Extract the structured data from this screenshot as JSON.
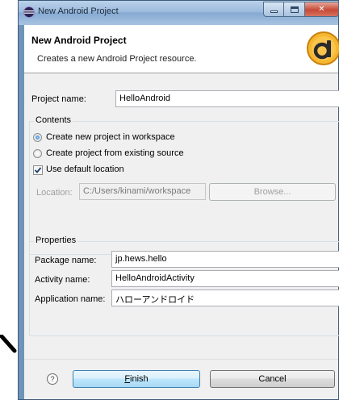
{
  "window": {
    "title": "New Android Project"
  },
  "banner": {
    "title": "New Android Project",
    "description": "Creates a new Android Project resource."
  },
  "project": {
    "name_label": "Project name:",
    "name_value": "HelloAndroid"
  },
  "contents": {
    "group_title": "Contents",
    "option_new": "Create new project in workspace",
    "option_existing": "Create project from existing source",
    "use_default_label": "Use default location",
    "location_label": "Location:",
    "location_value": "C:/Users/kinami/workspace",
    "browse_label": "Browse..."
  },
  "properties": {
    "group_title": "Properties",
    "package_label": "Package name:",
    "package_value": "jp.hews.hello",
    "activity_label": "Activity name:",
    "activity_value": "HelloAndroidActivity",
    "appname_label": "Application name:",
    "appname_value": "ハローアンドロイド"
  },
  "footer": {
    "help_symbol": "?",
    "finish_mnemonic": "F",
    "finish_rest": "inish",
    "cancel_label": "Cancel"
  },
  "icons": {
    "title_icon": "eclipse-icon",
    "logo": "android-adt-logo",
    "help": "help-icon"
  },
  "colors": {
    "accent": "#3c7fb1",
    "radio_selected": "#1c6fc4",
    "logo_orange": "#f0a420"
  }
}
